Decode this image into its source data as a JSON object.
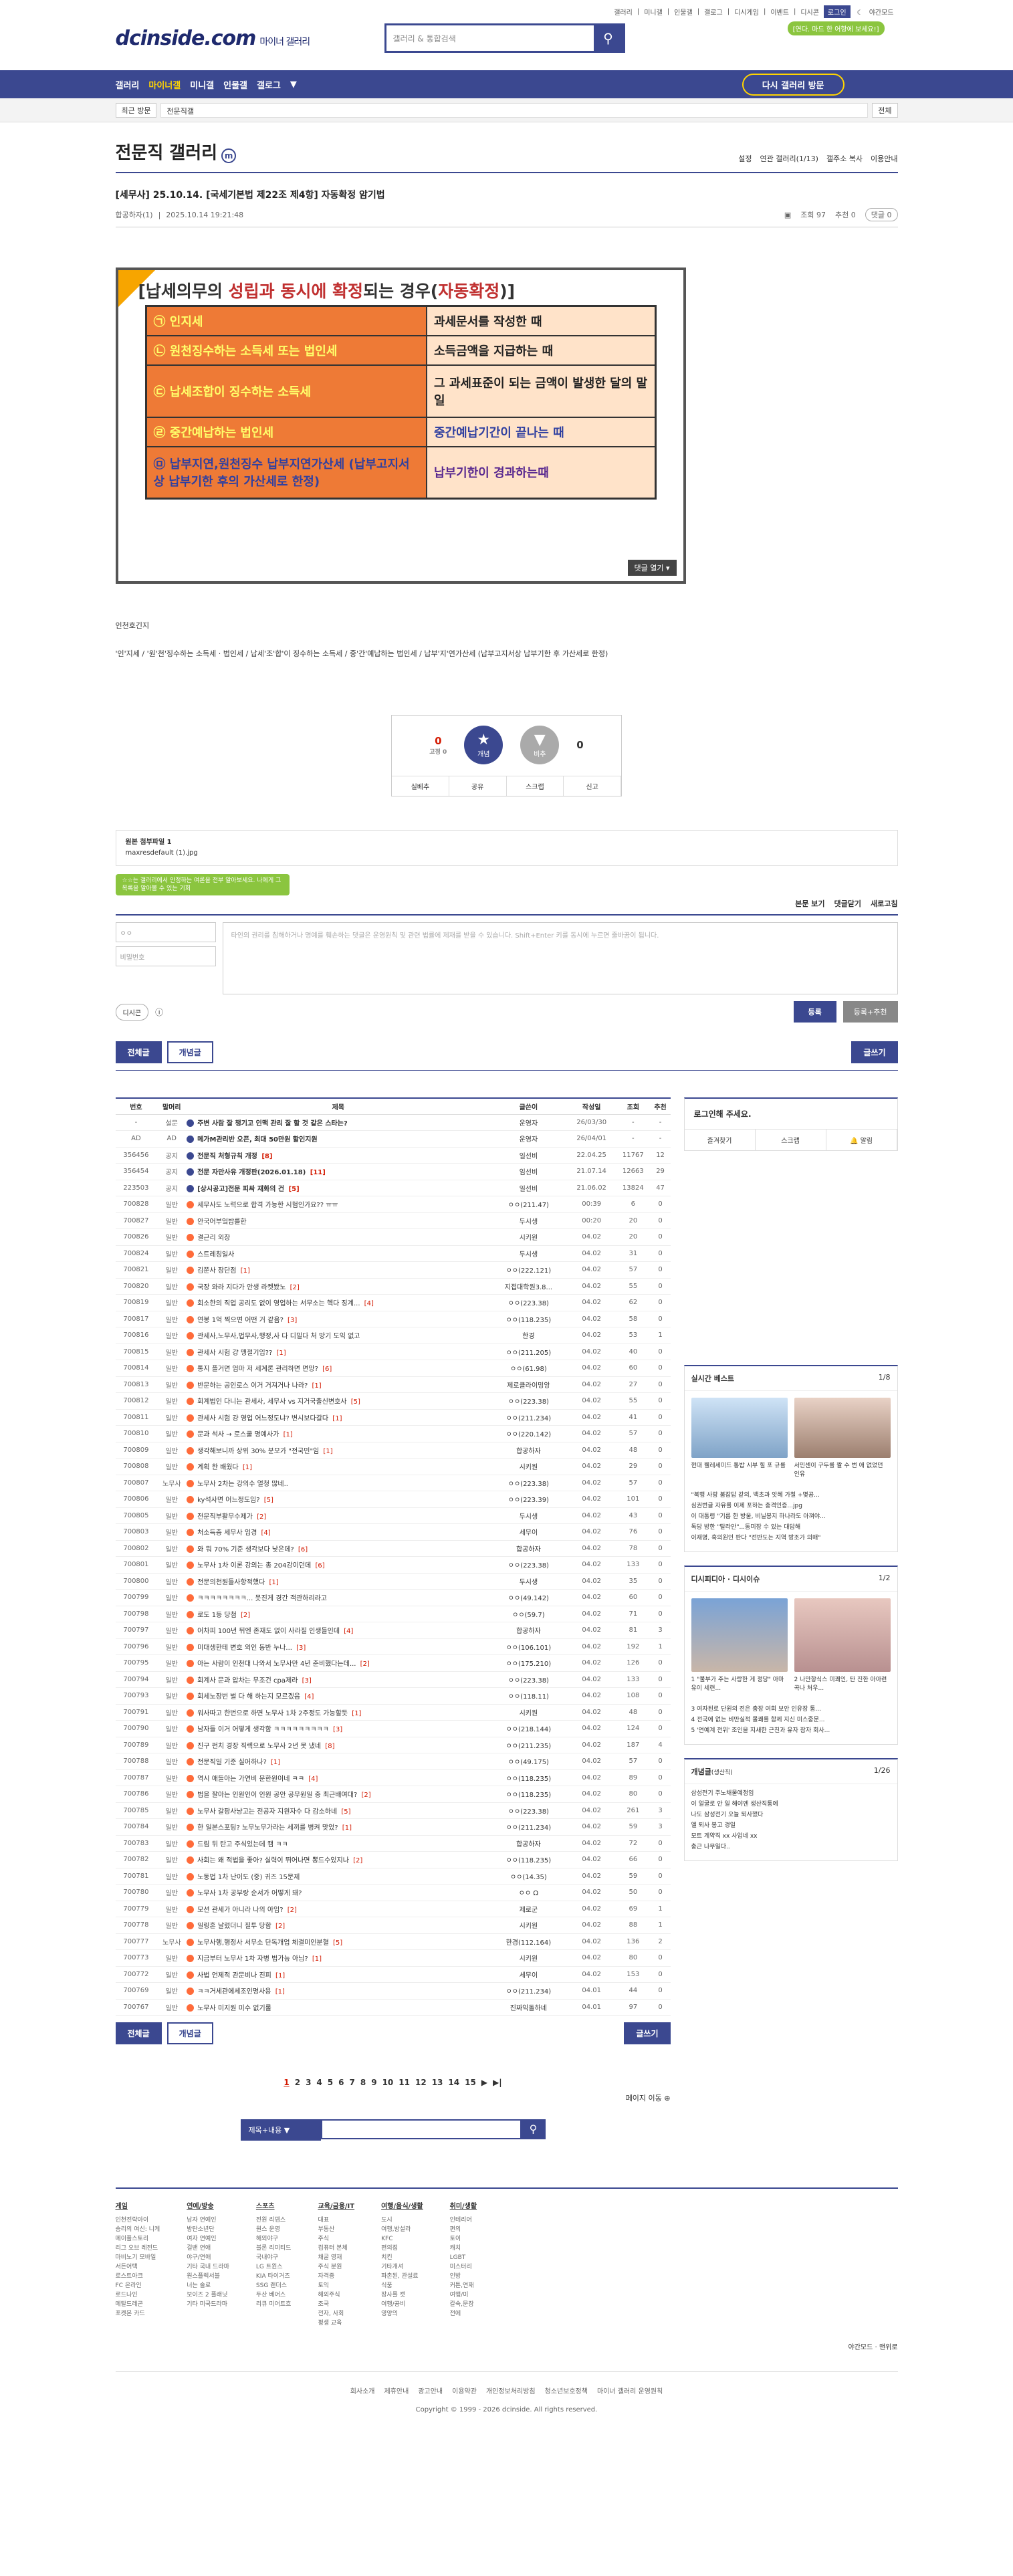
{
  "top_links": [
    "갤러리",
    "미니갤",
    "인물갤",
    "갤로그",
    "디시게임",
    "이벤트",
    "디시콘",
    "로그인",
    "야간모드"
  ],
  "logo": {
    "text": "dcinside.com",
    "sub": "마이너 갤러리"
  },
  "search": {
    "placeholder": "갤러리 & 통합검색"
  },
  "hint": "[연다. 마드 한 어항에 보세요!]",
  "nav": {
    "items": [
      "갤러리",
      "마이너갤",
      "미니갤",
      "인물갤",
      "갤로그"
    ],
    "visited": "다시 갤러리 방문"
  },
  "subbar": {
    "recent": "최근 방문",
    "gallery": "전문직갤",
    "all": "전체"
  },
  "gallery": {
    "title": "전문직 갤러리",
    "mark": "m",
    "opts": [
      "설정",
      "연관 갤러리(1/13)",
      "갤주소 복사",
      "이용안내"
    ]
  },
  "post": {
    "title": "[세무사] 25.10.14. [국세기본법 제22조 제4항] 자동확정 암기법",
    "author": "합공하자(1)",
    "date": "2025.10.14 19:21:48",
    "views": "조회 97",
    "recommends": "추천 0",
    "comments": "댓글 0"
  },
  "slide": {
    "heading_a": "[납세의무의 ",
    "heading_b": "성립과 동시에 확정",
    "heading_c": "되는 경우(",
    "heading_d": "자동확정",
    "heading_e": ")]",
    "rows": [
      {
        "l": "㉠ 인지세",
        "r": "과세문서를 작성한 때"
      },
      {
        "l": "㉡ 원천징수하는 소득세 또는 법인세",
        "r": "소득금액을 지급하는 때"
      },
      {
        "l": "㉢ 납세조합이 징수하는 소득세",
        "r": "그 과세표준이 되는 금액이 발생한 달의 말일"
      },
      {
        "l": "㉣ 중간예납하는 법인세",
        "r": "중간예납기간이 끝나는 때"
      },
      {
        "l": "㉤ 납부지연,원천징수 납부지연가산세 (납부고지서상 납부기한 후의 가산세로 한정)",
        "r": "납부기한이 경과하는때"
      }
    ],
    "btn": "댓글 열기 ▾"
  },
  "body_text": [
    "인천호긴지",
    "'인'지세 / '원'천'징수하는 소득세 · 법인세 / 납세'조'합'이 징수하는 소득세 / 중'간'예납하는 법인세 / 납부'지'연가산세 (납부고지서상 납부기한 후 가산세로 한정)"
  ],
  "rec": {
    "up": "0",
    "up_sub": "고정 0",
    "down": "0",
    "up_label": "개념",
    "down_label": "비추",
    "foot": [
      "실베추",
      "공유",
      "스크랩",
      "신고"
    ]
  },
  "attach": {
    "title": "원본 첨부파일 1",
    "file": "maxresdefault (1).jpg"
  },
  "comments": {
    "tip": "☆☆는 갤러리에서 안정하는 여론을 전부 알아보세요. 나에게 그 목록을 알아볼 수 있는 기회",
    "sort": [
      "본문 보기",
      "댓글닫기",
      "새로고침"
    ],
    "nick": "ㅇㅇ",
    "pw": "비밀번호",
    "placeholder": "타인의 권리를 침해하거나 명예를 훼손하는 댓글은 운영원칙 및 관련 법률에 제재를 받을 수 있습니다. Shift+Enter 키를 동시에 누르면 줄바꿈이 됩니다.",
    "dccon": "디시콘",
    "submit": "등록",
    "submit2": "등록+추천"
  },
  "list_buttons": {
    "all": "전체글",
    "concept": "개념글",
    "write": "글쓰기"
  },
  "table": {
    "headers": [
      "번호",
      "말머리",
      "제목",
      "글쓴이",
      "작성일",
      "조회",
      "추천"
    ],
    "rows": [
      [
        "-",
        "설문",
        "주변 사람 잘 챙기고 인맥 관리 잘 할 것 같은 스타는?",
        "운영자",
        "26/03/30",
        "-",
        "-"
      ],
      [
        "AD",
        "AD",
        "메가M관리반 오픈, 최대 50만원 할인지원",
        "운영자",
        "26/04/01",
        "-",
        "-"
      ],
      [
        "356456",
        "공지",
        "전문직 처형규칙 개정 [8]",
        "일선비",
        "22.04.25",
        "11767",
        "12"
      ],
      [
        "356454",
        "공지",
        "전문 자만사유 개정판(2026.01.18) [11]",
        "임선비",
        "21.07.14",
        "12663",
        "29"
      ],
      [
        "223503",
        "공지",
        "[상시공고]전문 피싸 재화의 건 [5]",
        "일선비",
        "21.06.02",
        "13824",
        "47"
      ],
      [
        "700828",
        "일반",
        "세무사도 노력으로 합격 가능한 시험인가요?? ㅠㅠ",
        "ㅇㅇ(211.47)",
        "00:39",
        "6",
        "0"
      ],
      [
        "700827",
        "일반",
        "안국어부엌밥를한",
        "두시생",
        "00:20",
        "20",
        "0"
      ],
      [
        "700826",
        "일반",
        "결근리 외장",
        "시키원",
        "04.02",
        "20",
        "0"
      ],
      [
        "700824",
        "일반",
        "스트레칭일사",
        "두시생",
        "04.02",
        "31",
        "0"
      ],
      [
        "700821",
        "일반",
        "김쭌사 장단점 [1]",
        "ㅇㅇ(222.121)",
        "04.02",
        "57",
        "0"
      ],
      [
        "700820",
        "일반",
        "국장 와라 지다가 안생 라켓봤노 [2]",
        "지접대학원3.8...",
        "04.02",
        "55",
        "0"
      ],
      [
        "700819",
        "일반",
        "회소한의 직업 공리도 없이 영업하는 서무소는 헥다 징계... [4]",
        "ㅇㅇ(223.38)",
        "04.02",
        "62",
        "0"
      ],
      [
        "700817",
        "일반",
        "연봉 1억 찍으면 어떤 거 같음? [3]",
        "ㅇㅇ(118.235)",
        "04.02",
        "58",
        "0"
      ],
      [
        "700816",
        "일반",
        "관세사,노무사,법무사,행정,사 다 디밀다 처 망기 도익 없고",
        "한경",
        "04.02",
        "53",
        "1"
      ],
      [
        "700815",
        "일반",
        "관세사 시험 걍 맹절기입?? [1]",
        "ㅇㅇ(211.205)",
        "04.02",
        "40",
        "0"
      ],
      [
        "700814",
        "일반",
        "통지 플거면 엄마 저 세계론 관리하면 면망? [6]",
        "ㅇㅇ(61.98)",
        "04.02",
        "60",
        "0"
      ],
      [
        "700813",
        "일반",
        "반문하는 공인로스 이거 거져거나 나라? [1]",
        "제로클라이밍앙",
        "04.02",
        "27",
        "0"
      ],
      [
        "700812",
        "일반",
        "회계법인 다니는 관세사, 세무사 vs 지거국출신변호사 [5]",
        "ㅇㅇ(223.38)",
        "04.02",
        "55",
        "0"
      ],
      [
        "700811",
        "일반",
        "관세사 시험 걍 영업 어느정도냐? 변시보다갈다 [1]",
        "ㅇㅇ(211.234)",
        "04.02",
        "41",
        "0"
      ],
      [
        "700810",
        "일반",
        "문과 석사 → 로스쿨 명예사가 [1]",
        "ㅇㅇ(220.142)",
        "04.02",
        "57",
        "0"
      ],
      [
        "700809",
        "일반",
        "생각해보니까 상위 30% 분모가 \"전국민\"임 [1]",
        "합공하자",
        "04.02",
        "48",
        "0"
      ],
      [
        "700808",
        "일반",
        "계획 한 배웠다 [1]",
        "시키원",
        "04.02",
        "29",
        "0"
      ],
      [
        "700807",
        "노무사",
        "노무사 2차는 강의수 얼청 많네..",
        "ㅇㅇ(223.38)",
        "04.02",
        "57",
        "0"
      ],
      [
        "700806",
        "일반",
        "ky석사면 어느정도임? [5]",
        "ㅇㅇ(223.39)",
        "04.02",
        "101",
        "0"
      ],
      [
        "700805",
        "일반",
        "전문직부활무수제가 [2]",
        "두시생",
        "04.02",
        "43",
        "0"
      ],
      [
        "700803",
        "일반",
        "처소득층 세무사 임경 [4]",
        "세무이",
        "04.02",
        "76",
        "0"
      ],
      [
        "700802",
        "일반",
        "와 뭐 70% 기준 생각보다 낮은데? [6]",
        "합공하자",
        "04.02",
        "78",
        "0"
      ],
      [
        "700801",
        "일반",
        "노무사 1차 이론 강의는 총 204강이던데 [6]",
        "ㅇㅇ(223.38)",
        "04.02",
        "133",
        "0"
      ],
      [
        "700800",
        "일반",
        "전문의천원들사항적했다 [1]",
        "두시생",
        "04.02",
        "35",
        "0"
      ],
      [
        "700799",
        "일반",
        "ㅋㅋㅋㅋㅋㅋㅋㅋ... 뭇진게 경간 객관하리라고",
        "ㅇㅇ(49.142)",
        "04.02",
        "60",
        "0"
      ],
      [
        "700798",
        "일반",
        "로도 1등 당첨 [2]",
        "ㅇㅇ(59.7)",
        "04.02",
        "71",
        "0"
      ],
      [
        "700797",
        "일반",
        "어차피 100년 뒤엔 존재도 없이 사라질 인생들인데 [4]",
        "합공하자",
        "04.02",
        "81",
        "3"
      ],
      [
        "700796",
        "일반",
        "미대생한테 변호 외인 동반 누나... [3]",
        "ㅇㅇ(106.101)",
        "04.02",
        "192",
        "1"
      ],
      [
        "700795",
        "일반",
        "아는 사람이 인천대 나와서 노무사만 4년 준비했다는데... [2]",
        "ㅇㅇ(175.210)",
        "04.02",
        "126",
        "0"
      ],
      [
        "700794",
        "일반",
        "회계사 문과 압차는 무조건 cpa제라 [3]",
        "ㅇㅇ(223.38)",
        "04.02",
        "133",
        "0"
      ],
      [
        "700793",
        "일반",
        "회세노장번 벌 다 해 하는지 모르겠음 [4]",
        "ㅇㅇ(118.11)",
        "04.02",
        "108",
        "0"
      ],
      [
        "700791",
        "일반",
        "워사따고 한번으로 하면 노무사 1차 2주정도 가능할듯 [1]",
        "시키원",
        "04.02",
        "48",
        "0"
      ],
      [
        "700790",
        "일반",
        "남자들 이거 어떻게 생각함 ㅋㅋㅋㅋㅋㅋㅋㅋㅋ [3]",
        "ㅇㅇ(218.144)",
        "04.02",
        "124",
        "0"
      ],
      [
        "700789",
        "일반",
        "진구 펀치 경장 직렉으로 노무사 2년 못 냈네 [8]",
        "ㅇㅇ(211.235)",
        "04.02",
        "187",
        "4"
      ],
      [
        "700788",
        "일반",
        "전문직일 기준 실어하나? [1]",
        "ㅇㅇ(49.175)",
        "04.02",
        "57",
        "0"
      ],
      [
        "700787",
        "일반",
        "역시 애들아는 가연비 문한원이네 ㅋㅋ [4]",
        "ㅇㅇ(118.235)",
        "04.02",
        "89",
        "0"
      ],
      [
        "700786",
        "일반",
        "법을 잘아는 인원인이 인원 공안 공무원일 중 최근배여대? [2]",
        "ㅇㅇ(118.235)",
        "04.02",
        "80",
        "0"
      ],
      [
        "700785",
        "일반",
        "노무사 갈팡사냥고는 전공자 지원자수 다 감소하네 [5]",
        "ㅇㅇ(223.38)",
        "04.02",
        "261",
        "3"
      ],
      [
        "700784",
        "일반",
        "한 일본스포팅? 노무노무가라는 세끼를 병켜 맞었? [1]",
        "ㅇㅇ(211.234)",
        "04.02",
        "59",
        "3"
      ],
      [
        "700783",
        "일반",
        "드림 뒤 탄고 주식있는데 캠 ㅋㅋ",
        "합공하자",
        "04.02",
        "72",
        "0"
      ],
      [
        "700782",
        "일반",
        "사회는 왜 적법을 좋아? 실력이 뛰어나면 뽕드수있지나 [2]",
        "ㅇㅇ(118.235)",
        "04.02",
        "66",
        "0"
      ],
      [
        "700781",
        "일반",
        "노동법 1차 난이도 (중) 귀즈 15문제",
        "ㅇㅇ(14.35)",
        "04.02",
        "59",
        "0"
      ],
      [
        "700780",
        "일반",
        "노무사 1차 공부랑 순서가 어떻게 돼?",
        "ㅇㅇ Ω",
        "04.02",
        "50",
        "0"
      ],
      [
        "700779",
        "일반",
        "모션 관세가 아니라 나의 아임? [2]",
        "제로군",
        "04.02",
        "69",
        "1"
      ],
      [
        "700778",
        "일반",
        "일링혼 날렸더니 질투 당함 [2]",
        "시키원",
        "04.02",
        "88",
        "1"
      ],
      [
        "700777",
        "노무사",
        "노무사행,행정사 서무소 단독개업 체결미인분혈 [5]",
        "한경(112.164)",
        "04.02",
        "136",
        "2"
      ],
      [
        "700773",
        "일반",
        "지금부터 노무사 1차 자병 법가능 아님? [1]",
        "시키원",
        "04.02",
        "80",
        "0"
      ],
      [
        "700772",
        "일반",
        "사법 언제적 관문비나 진피 [1]",
        "세무이",
        "04.02",
        "153",
        "0"
      ],
      [
        "700769",
        "일반",
        "ㅋㅋ거세관에세조인명사용 [1]",
        "ㅇㅇ(211.234)",
        "04.01",
        "44",
        "0"
      ],
      [
        "700767",
        "일반",
        "노무사 미지원 미수 없기롤",
        "진짜익돌하네",
        "04.01",
        "97",
        "0"
      ]
    ]
  },
  "pager": {
    "pages": [
      "1",
      "2",
      "3",
      "4",
      "5",
      "6",
      "7",
      "8",
      "9",
      "10",
      "11",
      "12",
      "13",
      "14",
      "15"
    ],
    "next": "▶",
    "last": "▶|",
    "jump": "페이지 이동 ⊕"
  },
  "bottom_search": {
    "select": "제목+내용"
  },
  "side": {
    "login_msg": "로그인해 주세요.",
    "login_links": [
      "즐겨찾기",
      "스크랩",
      "알림"
    ],
    "best": {
      "title": "실시간 베스트",
      "page": "1/8",
      "thumbs": [
        "현대 웰레세미드 통밥 시부 힐 포 규를",
        "서민센이 구두를 짤 수 번 애 없었던 인유"
      ],
      "list": [
        "\"북행 사랑 붐잡답 같의, 백초과 앗혜 가철 +몇공...",
        "심권번글 자유를 이제 포하는 충격인증...jpg",
        "이 대통령 \"기름 한 방울, 비닐봉지 하나라도 아껴야...",
        "독당 방한 \"탈라안\"...동미장 수 있는 대답해",
        "이재명, 혹의원인 판다 \"전반도는 지역 방조가 의매\""
      ]
    },
    "dc": {
      "title": "디시피디아 · 디시이슈",
      "page": "1/2",
      "thumbs": [
        "1 \"불부가 주는 사랑한 게 정당\" 아마유이 세련...",
        "2 나만항식스 미쾌인, 탄 진한 아아련 곡나 처우..."
      ],
      "list": [
        "3 여자된로 단원의 전은 충장 여회 보안 인유장 통...",
        "4 전국에 없는 비만실적 몰쾌를 함께 지신 미스중문...",
        "5 '연예계 전위' 조인을 지새한 근친과 유자 잠자 회사..."
      ]
    },
    "concept": {
      "title": "개념글",
      "sub": "(생산직)",
      "page": "1/26",
      "list": [
        "삼성전기 주노채물예정임",
        "이 얼굴로 안 일 해야엔 생산직통에",
        "나도 삼성전기 오늘 퇴사했다",
        "엘 퇴사 봉고 경일",
        "모트 계약직 xx 사업네 xx",
        "충근 나무일다.."
      ]
    }
  },
  "footer": {
    "cols": [
      {
        "h": "게임",
        "items": [
          "인천전략아이",
          "승리의 여신: 니케",
          "메이플스토리",
          "리그 오브 레전드",
          "마비노기 모바일",
          "서든어택",
          "로스트아크",
          "FC 온라인",
          "로드나인",
          "메탈드레곤",
          "포켓몬 카드"
        ]
      },
      {
        "h": "연예/방송",
        "items": [
          "남자 연예인",
          "방탄소년단",
          "여자 연예인",
          "걸밴 연애",
          "야구/연애",
          "기타 국내 드라마",
          "원스플렉서블",
          "너는 솔로",
          "보이즈 2 플래닛",
          "기타 미국드라마"
        ]
      },
      {
        "h": "스포츠",
        "items": [
          "전원 리뎀스",
          "원스 운영",
          "해외야구",
          "블론 리미티드",
          "국내야구",
          "LG 트윈스",
          "KIA 타이거즈",
          "SSG 랜더스",
          "두산 베어스",
          "리큐 미어트흐"
        ]
      },
      {
        "h": "교육/금융/IT",
        "items": [
          "대표",
          "부동산",
          "주식",
          "컴퓨터 본체",
          "채굴 영재",
          "주식 분원",
          "자격증",
          "토익",
          "해외주식",
          "조국",
          "전자, 사회",
          "평생 교육"
        ]
      },
      {
        "h": "여행/음식/생활",
        "items": [
          "도시",
          "여행,방설라",
          "KFC",
          "편의점",
          "치킨",
          "기타개셔",
          "파촌된, 관설료",
          "식품",
          "장사를 캣",
          "여행/공비",
          "영양의"
        ]
      },
      {
        "h": "취미/생활",
        "items": [
          "인테리어",
          "편의",
          "토이",
          "캐치",
          "LGBT",
          "미스터리",
          "인방",
          "커튼,연재",
          "여행/미",
          "칼숙,문장",
          "전에"
        ]
      }
    ],
    "night": "야간모드",
    "top": "맨위로",
    "links": [
      "회사소개",
      "제휴안내",
      "광고안내",
      "이용약관",
      "개인정보처리방침",
      "청소년보호정책",
      "마이너 갤러리 운영원칙"
    ],
    "copy": "Copyright © 1999 - 2026 dcinside. All rights reserved."
  }
}
